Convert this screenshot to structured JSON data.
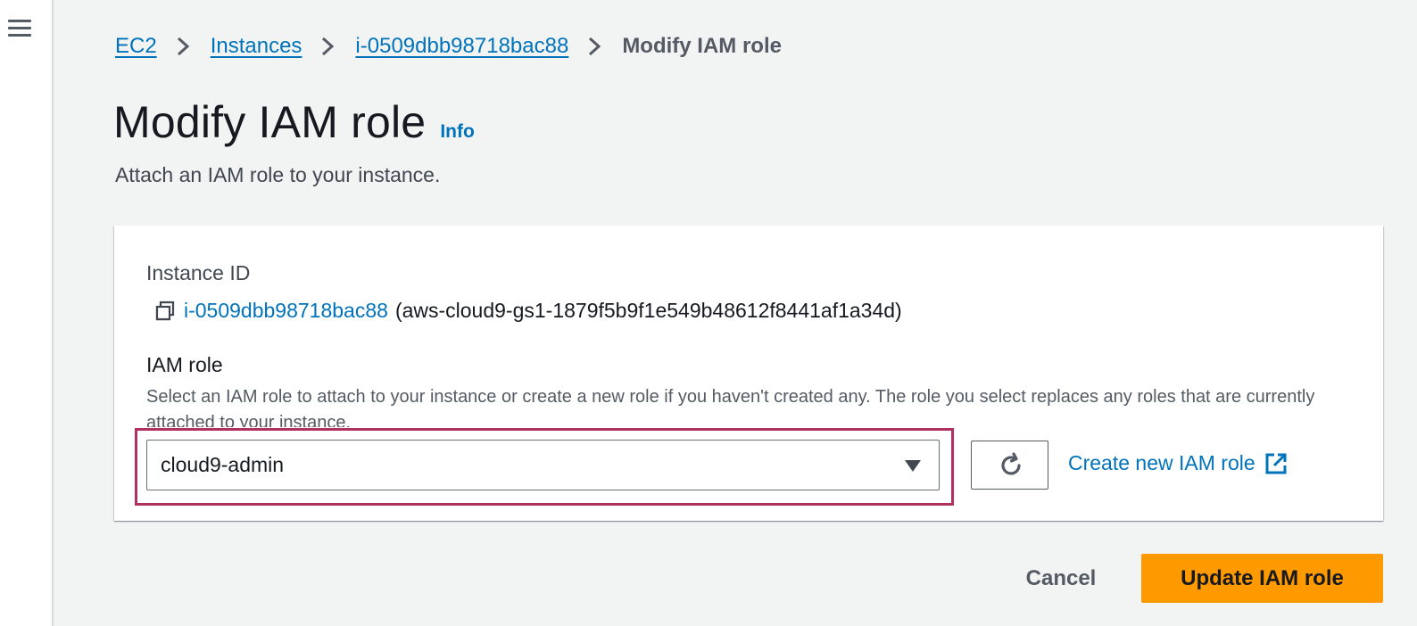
{
  "nav": {
    "menu_icon": "hamburger-icon"
  },
  "breadcrumb": {
    "items": [
      {
        "label": "EC2"
      },
      {
        "label": "Instances"
      },
      {
        "label": "i-0509dbb98718bac88"
      }
    ],
    "current": "Modify IAM role",
    "separator_icon": "chevron-right-icon"
  },
  "header": {
    "title": "Modify IAM role",
    "info_label": "Info",
    "description": "Attach an IAM role to your instance."
  },
  "form": {
    "instance_id_label": "Instance ID",
    "instance_id": "i-0509dbb98718bac88",
    "instance_name": "(aws-cloud9-gs1-1879f5b9f1e549b48612f8441af1a34d)",
    "copy_icon": "copy-icon",
    "iam_role_label": "IAM role",
    "iam_role_description": "Select an IAM role to attach to your instance or create a new role if you haven't created any. The role you select replaces any roles that are currently attached to your instance.",
    "iam_role_selected": "cloud9-admin",
    "refresh_icon": "refresh-icon",
    "create_role_label": "Create new IAM role",
    "external_link_icon": "external-link-icon"
  },
  "actions": {
    "cancel_label": "Cancel",
    "submit_label": "Update IAM role"
  },
  "colors": {
    "link": "#0073bb",
    "primary_button": "#ff9900",
    "highlight_border": "#b0305f",
    "page_background": "#f2f3f3"
  }
}
